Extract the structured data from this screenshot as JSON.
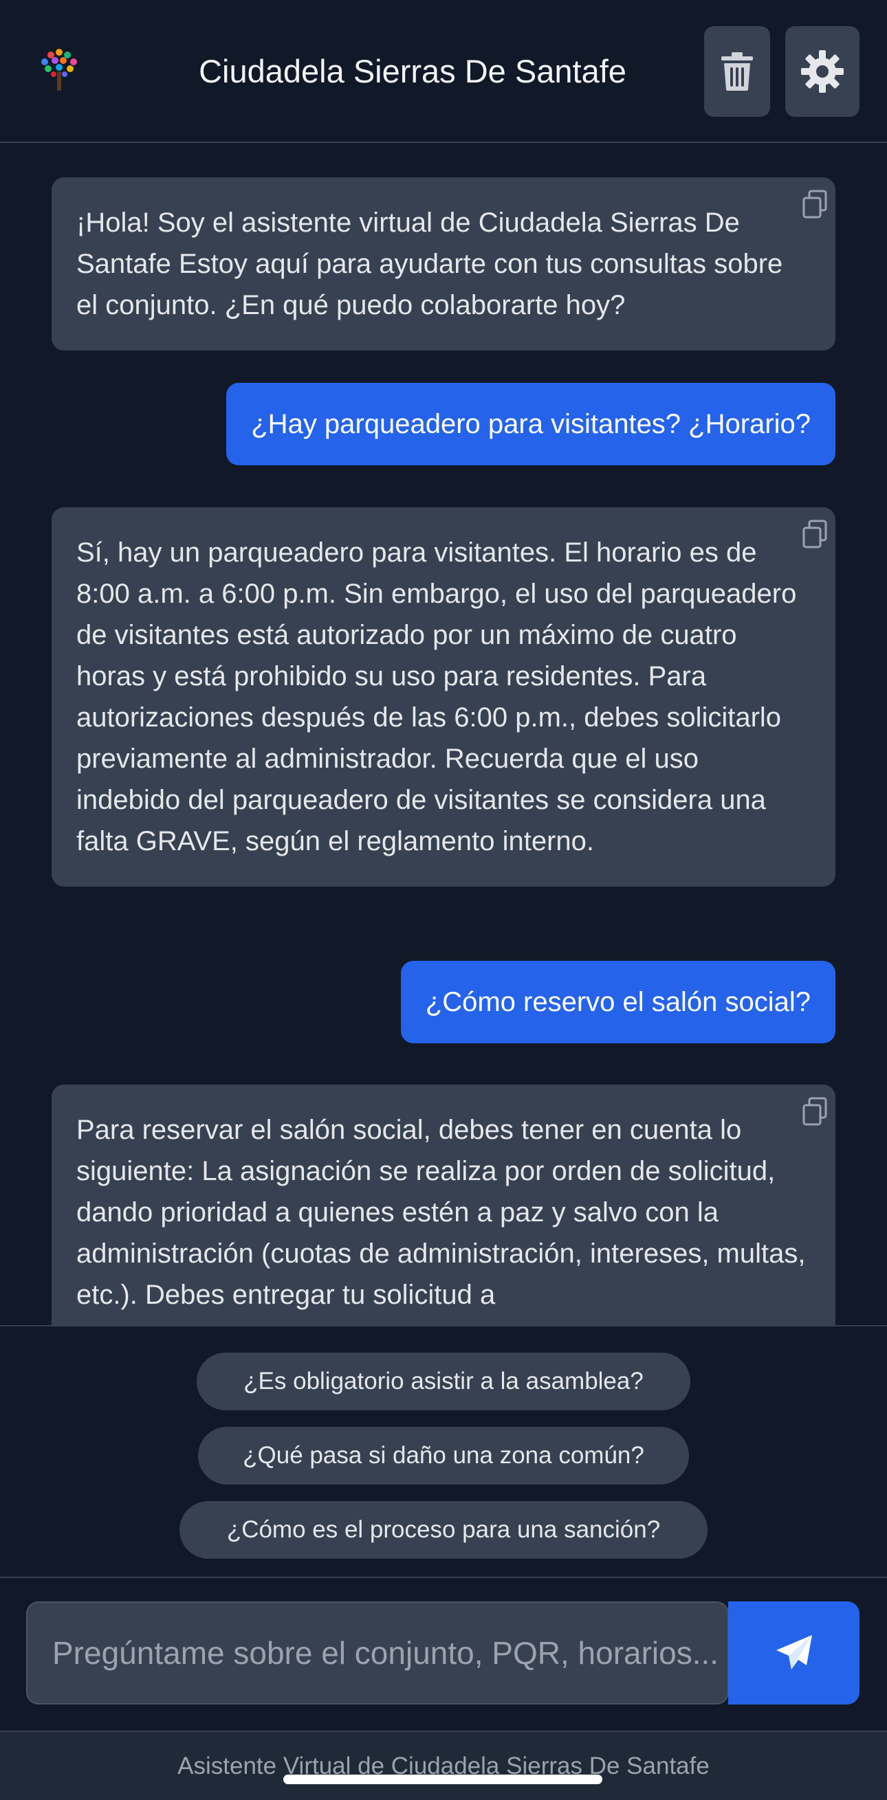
{
  "header": {
    "title": "Ciudadela Sierras De Santafe",
    "logo_icon": "tree-logo-icon",
    "delete_icon": "trash-icon",
    "settings_icon": "gear-icon"
  },
  "messages": [
    {
      "role": "bot",
      "text": "¡Hola! Soy el asistente virtual de Ciudadela Sierras De Santafe Estoy aquí para ayudarte con tus consultas sobre el conjunto. ¿En qué puedo colaborarte hoy?"
    },
    {
      "role": "user",
      "text": "¿Hay parqueadero para visitantes? ¿Horario?"
    },
    {
      "role": "bot",
      "text": "Sí, hay un parqueadero para visitantes. El horario es de 8:00 a.m. a 6:00 p.m. Sin embargo, el uso del parqueadero de visitantes está autorizado por un máximo de cuatro horas y está prohibido su uso para residentes. Para autorizaciones después de las 6:00 p.m., debes solicitarlo previamente al administrador. Recuerda que el uso indebido del parqueadero de visitantes se considera una falta GRAVE, según el reglamento interno."
    },
    {
      "role": "user",
      "text": "¿Cómo reservo el salón social?"
    },
    {
      "role": "bot",
      "text": "Para reservar el salón social, debes tener en cuenta lo siguiente: La asignación se realiza por orden de solicitud, dando prioridad a quienes estén a paz y salvo con la administración (cuotas de administración, intereses, multas, etc.). Debes entregar tu solicitud a"
    }
  ],
  "suggestions": [
    "¿Es obligatorio asistir a la asamblea?",
    "¿Qué pasa si daño una zona común?",
    "¿Cómo es el proceso para una sanción?"
  ],
  "input": {
    "placeholder": "Pregúntame sobre el conjunto, PQR, horarios..."
  },
  "send_icon": "paper-plane-icon",
  "footer": {
    "text": "Asistente Virtual de Ciudadela Sierras De Santafe"
  },
  "colors": {
    "background": "#111827",
    "bot_bubble": "#374151",
    "user_bubble": "#2563eb",
    "accent": "#2563eb"
  }
}
